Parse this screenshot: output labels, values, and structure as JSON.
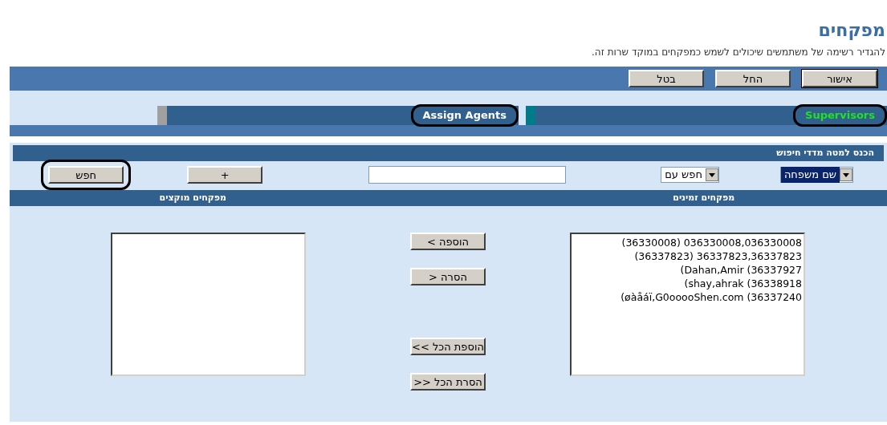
{
  "page": {
    "title": "מפקחים",
    "description": "להגדיר רשימה של משתמשים שיכולים לשמש כמפקחים במוקד שרות זה."
  },
  "toolbar_buttons": [
    {
      "label": "אישור",
      "default": true
    },
    {
      "label": "החל",
      "default": false
    },
    {
      "label": "בטל",
      "default": false
    }
  ],
  "tabs": [
    {
      "label": "Supervisors",
      "selected": true,
      "outlined": true
    },
    {
      "label": "Assign Agents",
      "selected": false,
      "outlined": true
    }
  ],
  "search": {
    "header": "הכנס למטה מדדי חיפוש",
    "field_select": "שם משפחה",
    "mode_select": "חפש עם",
    "add_button": "+",
    "search_button": {
      "label": "חפש",
      "outlined": true
    }
  },
  "available": {
    "header": "מפקחים זמינים",
    "items": [
      "(36330008) 036330008,036330008",
      "(36337823) 36337823,36337823",
      "(Dahan,Amir (36337927",
      "(shay,ahrak (36338918",
      "(øàåáï,G0ooooShen.com (36337240"
    ]
  },
  "assigned": {
    "header": "מפקחים מוקצים"
  },
  "transfer_buttons": [
    "הוספה >",
    "הסרה <",
    "הוספת הכל >>",
    "הסרת הכל <<"
  ]
}
